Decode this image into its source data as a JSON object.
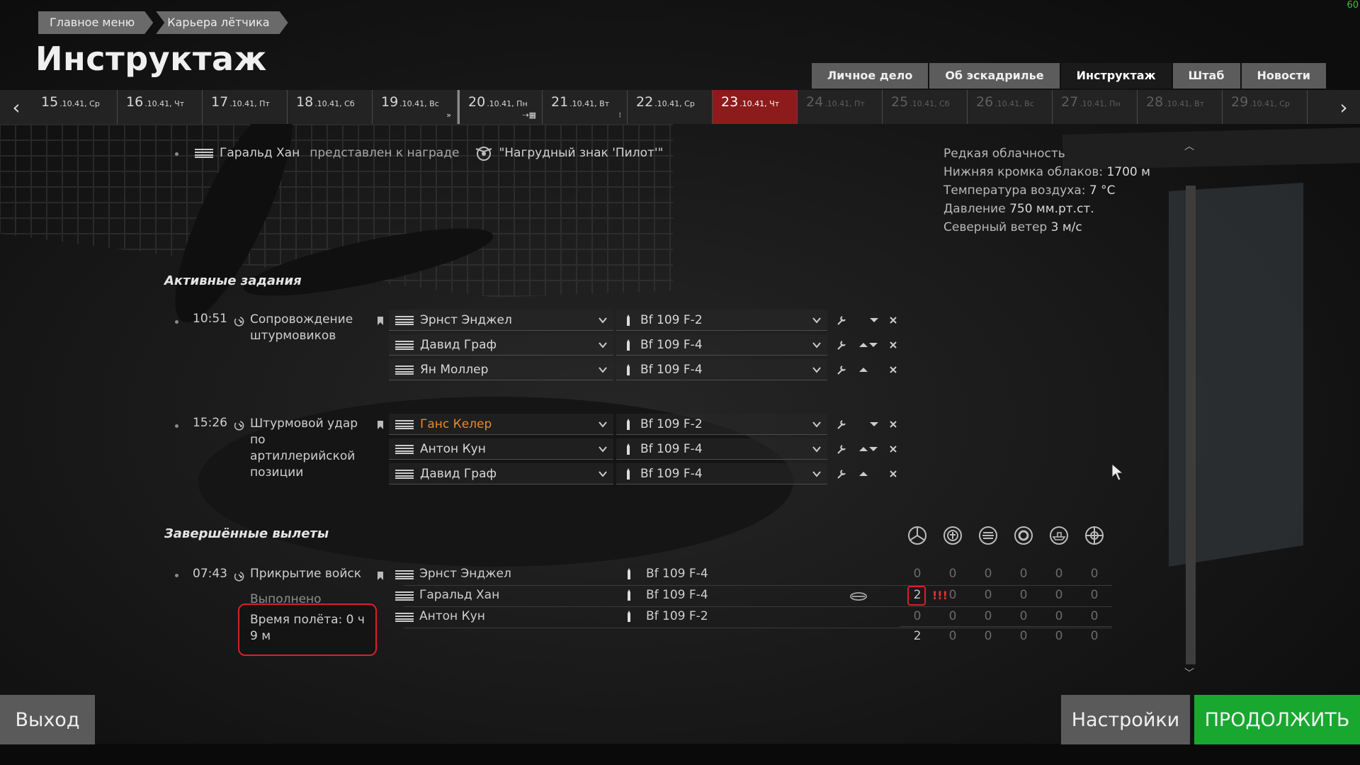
{
  "breadcrumb": [
    "Главное меню",
    "Карьера лётчика"
  ],
  "page_title": "Инструктаж",
  "fps": "60",
  "tabs": [
    {
      "label": "Личное дело",
      "active": false
    },
    {
      "label": "Об эскадрилье",
      "active": false
    },
    {
      "label": "Инструктаж",
      "active": true
    },
    {
      "label": "Штаб",
      "active": false
    },
    {
      "label": "Новости",
      "active": false
    }
  ],
  "days": [
    {
      "num": "15",
      "meta": ".10.41, Ср",
      "state": "past"
    },
    {
      "num": "16",
      "meta": ".10.41, Чт",
      "state": "past"
    },
    {
      "num": "17",
      "meta": ".10.41, Пт",
      "state": "past"
    },
    {
      "num": "18",
      "meta": ".10.41, Сб",
      "state": "past"
    },
    {
      "num": "19",
      "meta": ".10.41, Вс",
      "state": "past",
      "marker": "»"
    },
    {
      "num": "20",
      "meta": ".10.41, Пн",
      "state": "past",
      "marker": "⇢▦"
    },
    {
      "num": "21",
      "meta": ".10.41, Вт",
      "state": "past",
      "marker": "⁝"
    },
    {
      "num": "22",
      "meta": ".10.41, Ср",
      "state": "past"
    },
    {
      "num": "23",
      "meta": ".10.41, Чт",
      "state": "current"
    },
    {
      "num": "24",
      "meta": ".10.41, Пт",
      "state": "future"
    },
    {
      "num": "25",
      "meta": ".10.41, Сб",
      "state": "future"
    },
    {
      "num": "26",
      "meta": ".10.41, Вс",
      "state": "future"
    },
    {
      "num": "27",
      "meta": ".10.41, Пн",
      "state": "future"
    },
    {
      "num": "28",
      "meta": ".10.41, Вт",
      "state": "future"
    },
    {
      "num": "29",
      "meta": ".10.41, Ср",
      "state": "future"
    }
  ],
  "award": {
    "pilot": "Гаральд Хан",
    "text": "представлен к награде",
    "medal": "\"Нагрудный знак 'Пилот'\""
  },
  "weather": [
    {
      "label": "Редкая облачность",
      "value": ""
    },
    {
      "label": "Нижняя кромка облаков: ",
      "value": "1700 м"
    },
    {
      "label": "Температура воздуха: ",
      "value": "7 °C"
    },
    {
      "label": "Давление ",
      "value": "750 мм.рт.ст."
    },
    {
      "label": "Северный ветер ",
      "value": "3 м/с"
    }
  ],
  "active_title": "Активные задания",
  "active_missions": [
    {
      "time": "10:51",
      "name": "Сопровождение штурмовиков",
      "pilots": [
        {
          "name": "Эрнст Энджел",
          "plane": "Bf 109 F-2",
          "up": false,
          "down": true,
          "highlight": false
        },
        {
          "name": "Давид Граф",
          "plane": "Bf 109 F-4",
          "up": true,
          "down": true,
          "highlight": false
        },
        {
          "name": "Ян Моллер",
          "plane": "Bf 109 F-4",
          "up": true,
          "down": false,
          "highlight": false
        }
      ]
    },
    {
      "time": "15:26",
      "name": "Штурмовой удар по артиллерийской позиции",
      "pilots": [
        {
          "name": "Ганс Келер",
          "plane": "Bf 109 F-2",
          "up": false,
          "down": true,
          "highlight": true
        },
        {
          "name": "Антон Кун",
          "plane": "Bf 109 F-4",
          "up": true,
          "down": true,
          "highlight": false
        },
        {
          "name": "Давид Граф",
          "plane": "Bf 109 F-4",
          "up": true,
          "down": false,
          "highlight": false
        }
      ]
    }
  ],
  "completed_title": "Завершённые вылеты",
  "completed": {
    "time": "07:43",
    "name": "Прикрытие войск",
    "status": "Выполнено",
    "flight_time": "Время полёта: 0 ч 9 м",
    "rows": [
      {
        "name": "Эрнст Энджел",
        "plane": "Bf 109 F-4",
        "stats": [
          "0",
          "0",
          "0",
          "0",
          "0",
          "0"
        ],
        "awarded": false
      },
      {
        "name": "Гаральд Хан",
        "plane": "Bf 109 F-4",
        "stats": [
          "2",
          "0",
          "0",
          "0",
          "0",
          "0"
        ],
        "awarded": true
      },
      {
        "name": "Антон Кун",
        "plane": "Bf 109 F-2",
        "stats": [
          "0",
          "0",
          "0",
          "0",
          "0",
          "0"
        ],
        "awarded": false
      }
    ],
    "totals": [
      "2",
      "0",
      "0",
      "0",
      "0",
      "0"
    ],
    "alert": "!!!"
  },
  "stat_icons": [
    "fighter-kills-icon",
    "bomber-kills-icon",
    "ground-targets-icon",
    "armor-targets-icon",
    "ship-targets-icon",
    "other-targets-icon"
  ],
  "buttons": {
    "exit": "Выход",
    "settings": "Настройки",
    "continue": "ПРОДОЛЖИТЬ"
  },
  "colors": {
    "accent_red": "#8e1b1b",
    "continue_green": "#18a830",
    "highlight_orange": "#e88a2e",
    "alert_red": "#e23232"
  }
}
